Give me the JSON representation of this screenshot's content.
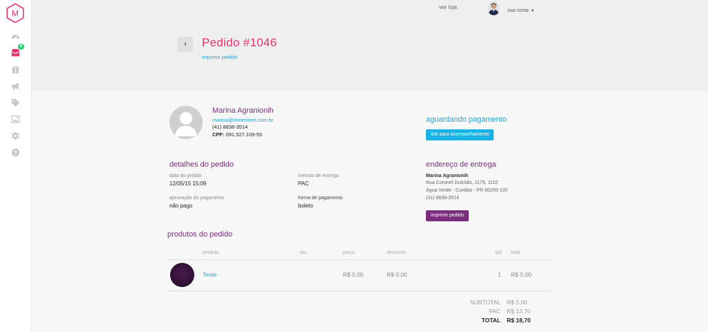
{
  "topbar": {
    "store_link": "ver loja",
    "account": "sua conta"
  },
  "sidebar": {
    "logo_letter": "M",
    "notifications_badge": "8"
  },
  "header": {
    "title": "Pedido #1046",
    "print_link": "imprimir pedido"
  },
  "customer": {
    "name": "Marina Agranionih",
    "email": "marina@minestore.com.br",
    "phone": "(41) 8838-3514",
    "cpf_label": "CPF:",
    "cpf": "091.527.109-55"
  },
  "status": {
    "text": "aguardando pagamento",
    "track_button": "link para acompanhamento"
  },
  "details": {
    "title": "detalhes do pedido",
    "order_date_label": "data do pedido",
    "order_date": "12/05/15 15:09",
    "delivery_method_label": "método de entrega",
    "delivery_method": "PAC",
    "payment_approval_label": "aprovação do pagamento",
    "payment_approval": "não pago",
    "payment_form_label": "forma de pagamento",
    "payment_form": "boleto"
  },
  "shipping": {
    "title": "endereço de entrega",
    "name": "Marina Agranionih",
    "line1": "Rua Coronel Dulcídio, 1179, 1102",
    "line2": "Água Verde - Curitiba - PR 80250-100",
    "phone": "(41) 8838-3514",
    "print_button": "imprimir pedido"
  },
  "products": {
    "title": "produtos do pedido",
    "headers": {
      "product": "produto",
      "sku": "sku",
      "price": "preço",
      "discount": "desconto",
      "qty": "qtd",
      "total": "total"
    },
    "rows": [
      {
        "name": "Teste",
        "sku": "",
        "price": "R$ 5,00",
        "discount": "R$ 0,00",
        "qty": "1",
        "total": "R$ 5,00"
      }
    ]
  },
  "totals": {
    "subtotal_label": "SUBTOTAL",
    "subtotal": "R$ 5,00",
    "shipping_label": "PAC",
    "shipping": "R$ 13,70",
    "total_label": "TOTAL",
    "total": "R$ 18,70"
  },
  "colors": {
    "accent_pink": "#e4336e",
    "accent_purple": "#7b2d7e",
    "accent_blue": "#18b3e4"
  }
}
